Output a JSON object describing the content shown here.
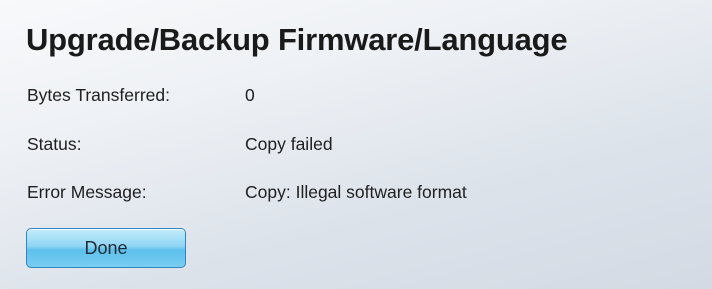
{
  "page": {
    "title": "Upgrade/Backup Firmware/Language"
  },
  "fields": {
    "bytes_transferred": {
      "label": "Bytes Transferred:",
      "value": "0"
    },
    "status": {
      "label": "Status:",
      "value": "Copy failed"
    },
    "error_message": {
      "label": "Error Message:",
      "value": "Copy: Illegal software format"
    }
  },
  "actions": {
    "done_label": "Done"
  },
  "colors": {
    "button_fill": "#8fd5f4",
    "button_border": "#2f86c0",
    "background": "#dde3eb"
  }
}
